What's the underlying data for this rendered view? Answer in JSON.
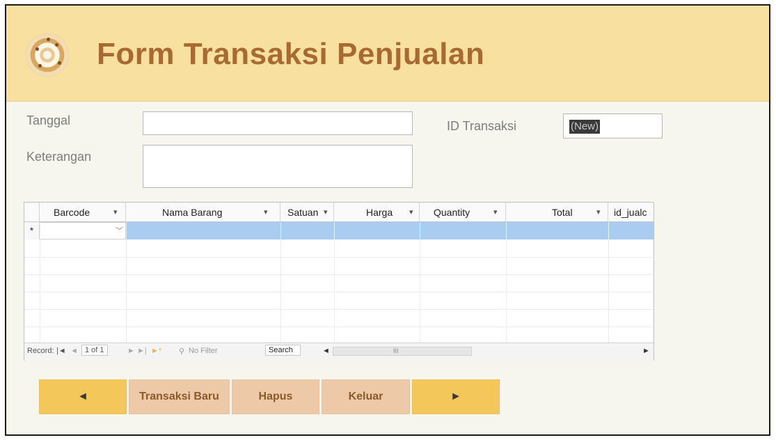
{
  "header": {
    "title": "Form Transaksi Penjualan"
  },
  "form": {
    "tanggal_label": "Tanggal",
    "tanggal_value": "",
    "keterangan_label": "Keterangan",
    "keterangan_value": "",
    "id_transaksi_label": "ID Transaksi",
    "id_transaksi_value": "(New)"
  },
  "grid": {
    "columns": [
      "Barcode",
      "Nama Barang",
      "Satuan",
      "Harga",
      "Quantity",
      "Total",
      "id_jualc"
    ],
    "new_row_marker": "*",
    "combo_arrow": "⌵"
  },
  "record_nav": {
    "record_label": "Record:",
    "position": "1 of 1",
    "filter_text": "No Filter",
    "search_text": "Search"
  },
  "buttons": {
    "prev": "◄",
    "new_transaction": "Transaksi Baru",
    "delete": "Hapus",
    "exit": "Keluar",
    "next": "►"
  }
}
